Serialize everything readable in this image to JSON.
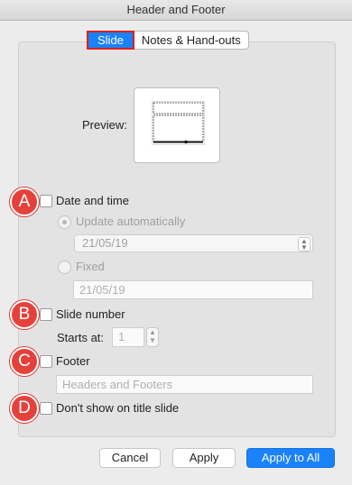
{
  "window": {
    "title": "Header and Footer"
  },
  "tabs": {
    "slide": "Slide",
    "notes": "Notes & Hand-outs"
  },
  "preview": {
    "label": "Preview:"
  },
  "date_time": {
    "label": "Date and time",
    "update_auto_label": "Update automatically",
    "auto_value": "21/05/19",
    "fixed_label": "Fixed",
    "fixed_value": "21/05/19"
  },
  "slide_number": {
    "label": "Slide number",
    "starts_at_label": "Starts at:",
    "starts_at_value": "1"
  },
  "footer": {
    "label": "Footer",
    "placeholder": "Headers and Footers"
  },
  "title_slide": {
    "label": "Don't show on title slide"
  },
  "badges": {
    "a": "A",
    "b": "B",
    "c": "C",
    "d": "D"
  },
  "buttons": {
    "cancel": "Cancel",
    "apply": "Apply",
    "apply_all": "Apply to All"
  },
  "colors": {
    "accent": "#1a82fb",
    "badge": "#e5413b",
    "highlight_border": "#e41d1d"
  }
}
